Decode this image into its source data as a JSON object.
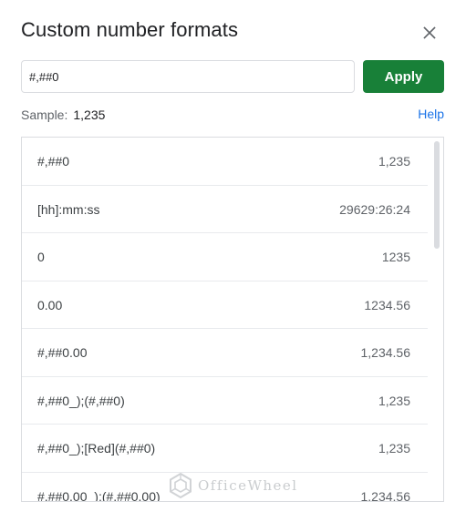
{
  "dialog": {
    "title": "Custom number formats",
    "close_icon": "close-icon"
  },
  "format_input": {
    "value": "#,##0"
  },
  "apply_button": {
    "label": "Apply",
    "color": "#188038"
  },
  "sample": {
    "label": "Sample:",
    "value": "1,235"
  },
  "help": {
    "label": "Help",
    "color": "#1a73e8"
  },
  "formats": [
    {
      "format": "#,##0",
      "sample": "1,235"
    },
    {
      "format": "[hh]:mm:ss",
      "sample": "29629:26:24"
    },
    {
      "format": "0",
      "sample": "1235"
    },
    {
      "format": "0.00",
      "sample": "1234.56"
    },
    {
      "format": "#,##0.00",
      "sample": "1,234.56"
    },
    {
      "format": "#,##0_);(#,##0)",
      "sample": "1,235"
    },
    {
      "format": "#,##0_);[Red](#,##0)",
      "sample": "1,235"
    },
    {
      "format": "#,##0.00_);(#,##0.00)",
      "sample": "1,234.56"
    }
  ],
  "watermark": {
    "text": "OfficeWheel",
    "icon": "officewheel-logo-icon"
  }
}
